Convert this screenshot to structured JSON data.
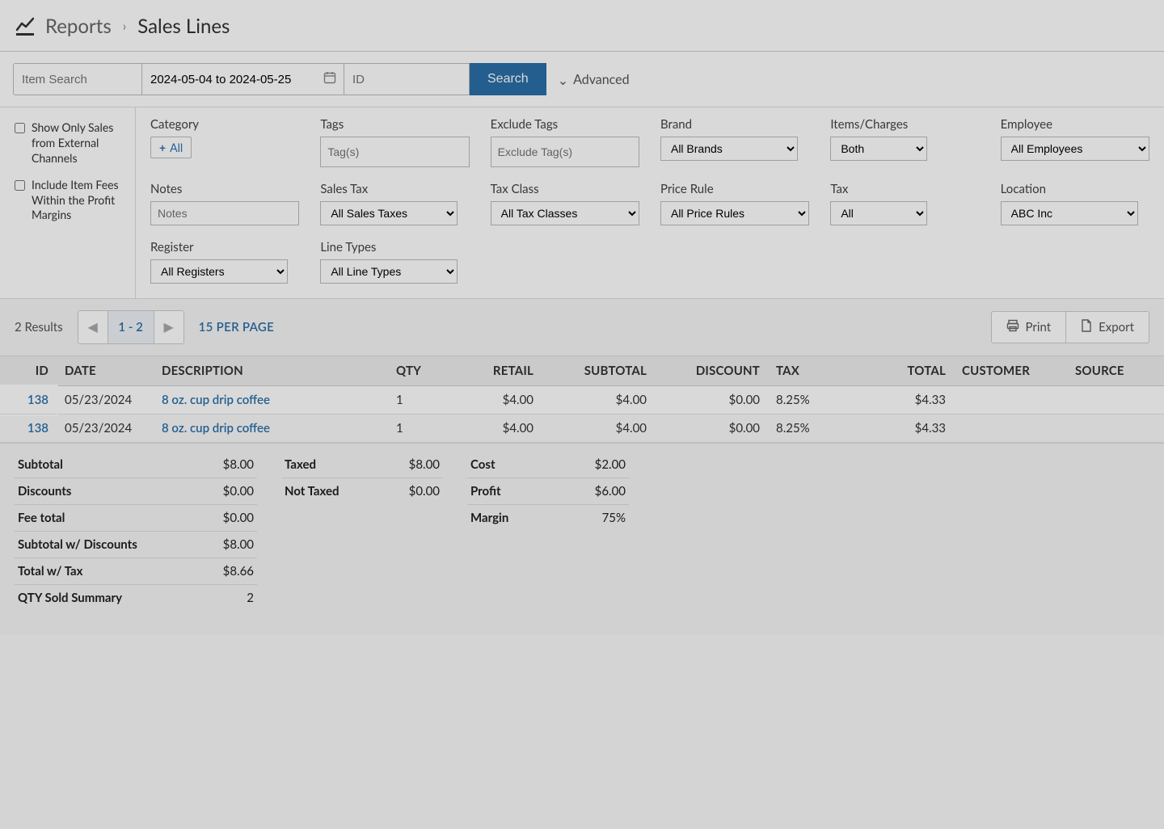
{
  "header": {
    "crumb_reports": "Reports",
    "crumb_current": "Sales Lines"
  },
  "search": {
    "item_placeholder": "Item Search",
    "date_value": "2024-05-04 to 2024-05-25",
    "id_placeholder": "ID",
    "search_label": "Search",
    "advanced_label": "Advanced"
  },
  "sidebar": {
    "chk1": "Show Only Sales from External Channels",
    "chk2": "Include Item Fees Within the Profit Margins"
  },
  "filters": {
    "category_label": "Category",
    "category_all": "All",
    "tags_label": "Tags",
    "tags_placeholder": "Tag(s)",
    "exclude_tags_label": "Exclude Tags",
    "exclude_tags_placeholder": "Exclude Tag(s)",
    "brand_label": "Brand",
    "brand_value": "All Brands",
    "items_charges_label": "Items/Charges",
    "items_charges_value": "Both",
    "employee_label": "Employee",
    "employee_value": "All Employees",
    "notes_label": "Notes",
    "notes_placeholder": "Notes",
    "sales_tax_label": "Sales Tax",
    "sales_tax_value": "All Sales Taxes",
    "tax_class_label": "Tax Class",
    "tax_class_value": "All Tax Classes",
    "price_rule_label": "Price Rule",
    "price_rule_value": "All Price Rules",
    "tax_label": "Tax",
    "tax_value": "All",
    "location_label": "Location",
    "location_value": "ABC Inc",
    "register_label": "Register",
    "register_value": "All Registers",
    "line_types_label": "Line Types",
    "line_types_value": "All Line Types"
  },
  "results": {
    "count_text": "2 Results",
    "page_text": "1 - 2",
    "per_page": "15 PER PAGE",
    "print": "Print",
    "export": "Export"
  },
  "table": {
    "headers": {
      "id": "ID",
      "date": "DATE",
      "description": "DESCRIPTION",
      "qty": "QTY",
      "retail": "RETAIL",
      "subtotal": "SUBTOTAL",
      "discount": "DISCOUNT",
      "tax": "TAX",
      "total": "TOTAL",
      "customer": "CUSTOMER",
      "source": "SOURCE"
    },
    "rows": [
      {
        "id": "138",
        "date": "05/23/2024",
        "description": "8 oz. cup drip coffee",
        "qty": "1",
        "retail": "$4.00",
        "subtotal": "$4.00",
        "discount": "$0.00",
        "tax": "8.25%",
        "total": "$4.33",
        "customer": "",
        "source": ""
      },
      {
        "id": "138",
        "date": "05/23/2024",
        "description": "8 oz. cup drip coffee",
        "qty": "1",
        "retail": "$4.00",
        "subtotal": "$4.00",
        "discount": "$0.00",
        "tax": "8.25%",
        "total": "$4.33",
        "customer": "",
        "source": ""
      }
    ]
  },
  "summary": {
    "col1": {
      "subtotal_l": "Subtotal",
      "subtotal_v": "$8.00",
      "discounts_l": "Discounts",
      "discounts_v": "$0.00",
      "fee_l": "Fee total",
      "fee_v": "$0.00",
      "subdisc_l": "Subtotal w/ Discounts",
      "subdisc_v": "$8.00",
      "totaltax_l": "Total w/ Tax",
      "totaltax_v": "$8.66",
      "qtysold_l": "QTY Sold Summary",
      "qtysold_v": "2"
    },
    "col2": {
      "taxed_l": "Taxed",
      "taxed_v": "$8.00",
      "nottaxed_l": "Not Taxed",
      "nottaxed_v": "$0.00"
    },
    "col3": {
      "cost_l": "Cost",
      "cost_v": "$2.00",
      "profit_l": "Profit",
      "profit_v": "$6.00",
      "margin_l": "Margin",
      "margin_v": "75%"
    }
  }
}
